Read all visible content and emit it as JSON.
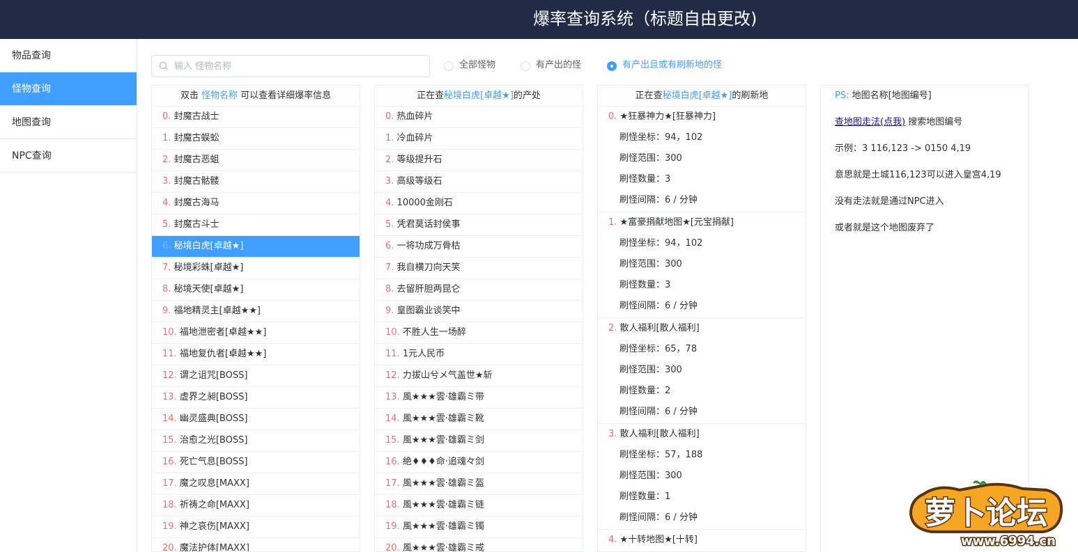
{
  "header": {
    "title": "爆率查询系统（标题自由更改)"
  },
  "sidebar": {
    "items": [
      {
        "label": "物品查询"
      },
      {
        "label": "怪物查询"
      },
      {
        "label": "地图查询"
      },
      {
        "label": "NPC查询"
      }
    ],
    "active_index": 1
  },
  "search": {
    "placeholder": "输入 怪物名称",
    "value": ""
  },
  "filters": {
    "options": [
      {
        "label": "全部怪物"
      },
      {
        "label": "有产出的怪"
      },
      {
        "label": "有产出且或有刷新地的怪"
      }
    ],
    "selected_index": 2
  },
  "monster_list": {
    "header_pre": "双击",
    "header_link": "怪物名称",
    "header_post": "可以查看详细爆率信息",
    "selected_index": 6,
    "items": [
      {
        "idx": "0.",
        "name": "封魔古战士"
      },
      {
        "idx": "1.",
        "name": "封魔古蜈蚣"
      },
      {
        "idx": "2.",
        "name": "封魔古恶蛆"
      },
      {
        "idx": "3.",
        "name": "封魔古骷髅"
      },
      {
        "idx": "4.",
        "name": "封魔古海马"
      },
      {
        "idx": "5.",
        "name": "封魔古斗士"
      },
      {
        "idx": "6.",
        "name": "秘境白虎[卓越★]"
      },
      {
        "idx": "7.",
        "name": "秘境彩蛛[卓越★]"
      },
      {
        "idx": "8.",
        "name": "秘境天使[卓越★]"
      },
      {
        "idx": "9.",
        "name": "福地精灵主[卓越★★]"
      },
      {
        "idx": "10.",
        "name": "福地泄密者[卓越★★]"
      },
      {
        "idx": "11.",
        "name": "福地复仇者[卓越★★]"
      },
      {
        "idx": "12.",
        "name": "谓之诅咒[BOSS]"
      },
      {
        "idx": "13.",
        "name": "虚界之昶[BOSS]"
      },
      {
        "idx": "14.",
        "name": "幽灵盛典[BOSS]"
      },
      {
        "idx": "15.",
        "name": "治愈之光[BOSS]"
      },
      {
        "idx": "16.",
        "name": "死亡气息[BOSS]"
      },
      {
        "idx": "17.",
        "name": "魔之叹息[MAXX]"
      },
      {
        "idx": "18.",
        "name": "祈祷之命[MAXX]"
      },
      {
        "idx": "19.",
        "name": "神之哀伤[MAXX]"
      },
      {
        "idx": "20.",
        "name": "魔法护体[MAXX]"
      }
    ]
  },
  "drops": {
    "header_pre": "正在查",
    "header_name": "秘境白虎[卓越★]",
    "header_post": "的产处",
    "items": [
      {
        "idx": "0.",
        "name": "热血碎片"
      },
      {
        "idx": "1.",
        "name": "冷血碎片"
      },
      {
        "idx": "2.",
        "name": "等级提升石"
      },
      {
        "idx": "3.",
        "name": "高级等级石"
      },
      {
        "idx": "4.",
        "name": "10000金刚石"
      },
      {
        "idx": "5.",
        "name": "凭君莫话封侯事"
      },
      {
        "idx": "6.",
        "name": "一将功成万骨枯"
      },
      {
        "idx": "7.",
        "name": "我自横刀向天笑"
      },
      {
        "idx": "8.",
        "name": "去留肝胆两昆仑"
      },
      {
        "idx": "9.",
        "name": "皇图霸业谈笑中"
      },
      {
        "idx": "10.",
        "name": "不胜人生一场醉"
      },
      {
        "idx": "11.",
        "name": "1元人民币"
      },
      {
        "idx": "12.",
        "name": "力拔山兮メ气盖世★斩"
      },
      {
        "idx": "13.",
        "name": "風★★★雲·雄霸ミ带"
      },
      {
        "idx": "14.",
        "name": "風★★★雲·雄霸ミ靴"
      },
      {
        "idx": "15.",
        "name": "風★★★雲·雄霸ミ剑"
      },
      {
        "idx": "16.",
        "name": "絶♦♦♦命·追魂々剑"
      },
      {
        "idx": "17.",
        "name": "風★★★雲·雄霸ミ盔"
      },
      {
        "idx": "18.",
        "name": "風★★★雲·雄霸ミ链"
      },
      {
        "idx": "19.",
        "name": "風★★★雲·雄霸ミ镯"
      },
      {
        "idx": "20.",
        "name": "風★★★雲·雄霸ミ戒"
      }
    ]
  },
  "spawns": {
    "header_pre": "正在查",
    "header_name": "秘境白虎[卓越★]",
    "header_post": "的刷新地",
    "labels": {
      "coord": "刷怪坐标：",
      "range": "刷怪范围：",
      "count": "刷怪数量：",
      "interval": "刷怪间隔："
    },
    "maps": [
      {
        "idx": "0.",
        "name": "★狂暴神力★[狂暴神力]",
        "coord": "94，102",
        "range": "300",
        "count": "3",
        "interval": "6 / 分钟"
      },
      {
        "idx": "1.",
        "name": "★富豪捐献地图★[元宝捐献]",
        "coord": "94，102",
        "range": "300",
        "count": "3",
        "interval": "6 / 分钟"
      },
      {
        "idx": "2.",
        "name": "散人福利[散人福利]",
        "coord": "65，78",
        "range": "300",
        "count": "2",
        "interval": "6 / 分钟"
      },
      {
        "idx": "3.",
        "name": "散人福利[散人福利]",
        "coord": "57，188",
        "range": "300",
        "count": "1",
        "interval": "6 / 分钟"
      },
      {
        "idx": "4.",
        "name": "★十转地图★[十转]"
      }
    ]
  },
  "ps": {
    "label": "PS:",
    "text": "地图名称[地图编号]",
    "link_text": "查地图走法(点我)",
    "link_suffix": "搜索地图编号",
    "lines": [
      "示例：3 116,123 -> 0150 4,19",
      "意思就是土城116,123可以进入皇宫4,19",
      "没有走法就是通过NPC进入",
      "或者就是这个地图废弃了"
    ]
  },
  "watermark": {
    "text": "萝卜论坛",
    "url": "www.6994.cn"
  },
  "colors": {
    "header_bg": "#212b45",
    "accent": "#409eff",
    "index": "#f56c6c",
    "logo_orange": "#f5a623"
  }
}
